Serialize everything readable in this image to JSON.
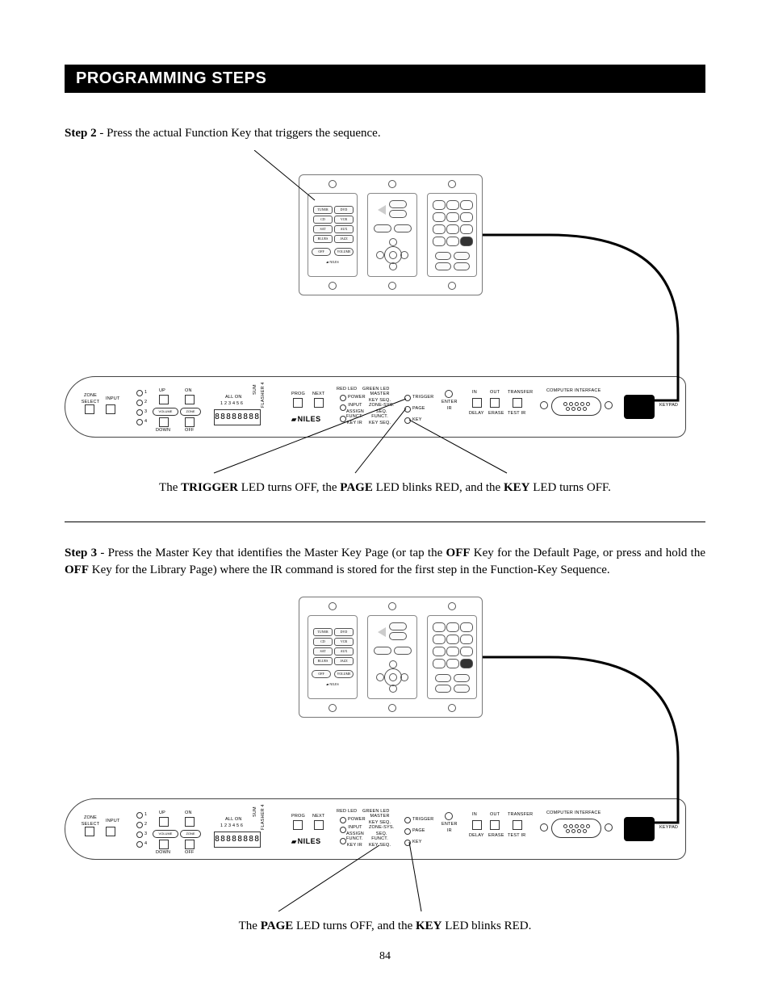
{
  "page_number": "84",
  "section_title": "PROGRAMMING STEPS",
  "step2": {
    "label": "Step 2",
    "text": " - Press the actual Function Key that triggers the sequence.",
    "caption_pre": "The ",
    "caption_parts": [
      "TRIGGER",
      " LED turns OFF, the ",
      "PAGE",
      " LED blinks RED, and the ",
      "KEY",
      " LED turns OFF."
    ]
  },
  "step3": {
    "label": "Step 3",
    "text": " - Press the Master Key that identifies the Master Key Page (or tap the ",
    "bold1": "OFF",
    "text2": " Key for the Default Page, or press and hold the ",
    "bold2": "OFF",
    "text3": " Key for the Library Page) where the IR command is stored for the first step in the Function-Key Sequence.",
    "caption_pre": "The ",
    "caption_parts": [
      "PAGE",
      " LED turns OFF, and the ",
      "KEY",
      " LED blinks RED."
    ]
  },
  "panel_labels": {
    "zone_select": "ZONE\nSELECT",
    "input": "INPUT",
    "ups": [
      "1",
      "2",
      "3",
      "4"
    ],
    "up": "UP",
    "down": "DOWN",
    "on": "ON",
    "off": "OFF",
    "volume": "VOLUME",
    "zone": "ZONE",
    "all_on": "ALL ON",
    "nums": "1 2 3 4 5 6",
    "sum": "SUM",
    "flasher": "FLASHER 4",
    "display": "88888888",
    "niles": "NILES",
    "prog": "PROG",
    "next": "NEXT",
    "red_led": "RED LED",
    "green_led": "GREEN LED",
    "power": "POWER",
    "master_key_seq": "MASTER\nKEY SEQ.",
    "input_assign": "INPUT\nASSIGN",
    "zone_sys_seq": "ZONE-SYS.\nSEQ.",
    "funct_key_ir": "FUNCT.\nKEY IR",
    "funct_key_seq": "FUNCT.\nKEY SEQ.",
    "trigger": "TRIGGER",
    "page": "PAGE",
    "key": "KEY",
    "enter_ir": "ENTER\nIR",
    "in": "IN",
    "out": "OUT",
    "transfer": "TRANSFER",
    "delay": "DELAY",
    "erase": "ERASE",
    "test_ir": "TEST IR",
    "computer_interface": "COMPUTER INTERFACE",
    "keypad": "KEYPAD"
  },
  "keypad_labels": {
    "col1": [
      "TUNER",
      "DVD",
      "CD",
      "VCR",
      "SAT",
      "AUX",
      "BLUES",
      "JAZZ"
    ],
    "off": "OFF",
    "vol": "VOLUME",
    "brand": "NILES"
  }
}
